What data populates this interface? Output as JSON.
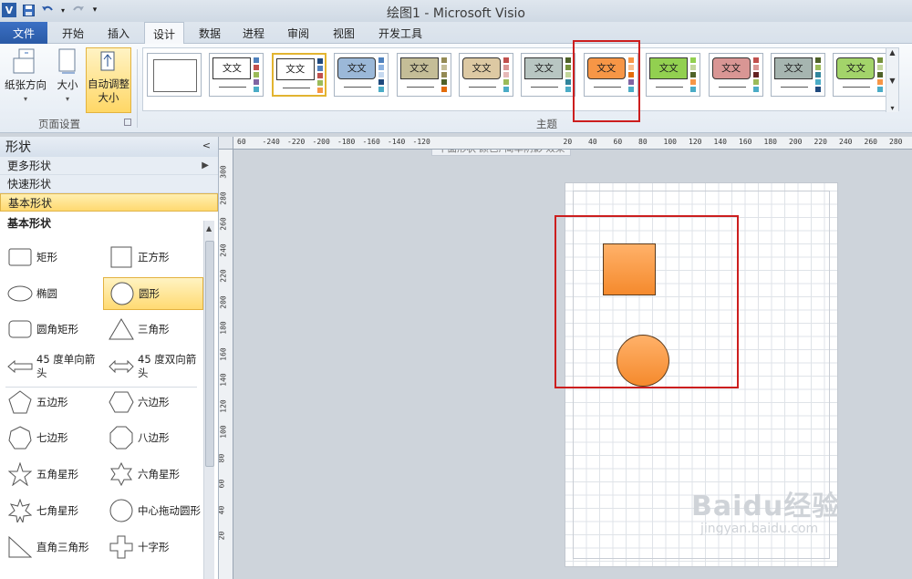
{
  "titlebar": {
    "title": "绘图1 - Microsoft Visio"
  },
  "qat": {
    "app_icon": "V",
    "items": [
      "save-icon",
      "undo-icon",
      "redo-icon",
      "customize-qat-icon"
    ]
  },
  "tabs": {
    "file": "文件",
    "items": [
      "开始",
      "插入",
      "设计",
      "数据",
      "进程",
      "审阅",
      "视图",
      "开发工具"
    ],
    "active": "设计"
  },
  "ribbon": {
    "page_setup": {
      "orientation": "纸张方向",
      "size": "大小",
      "auto_size_line1": "自动调整",
      "auto_size_line2": "大小",
      "group_label": "页面设置"
    },
    "themes": {
      "group_label": "主题",
      "sample_text": "文文",
      "tooltip": "平面形状 颜色, 简单阴影 效果",
      "items": [
        {
          "fill": "#ffffff",
          "border": "#666666",
          "bar": [
            "#c8c8c8",
            "#c8c8c8",
            "#c8c8c8",
            "#c8c8c8",
            "#c8c8c8"
          ],
          "blank": true
        },
        {
          "fill": "#ffffff",
          "border": "#333333",
          "bar": [
            "#4f81bd",
            "#c0504d",
            "#9bbb59",
            "#8064a2",
            "#4bacc6"
          ]
        },
        {
          "fill": "#ffffff",
          "border": "#333333",
          "bar": [
            "#1f497d",
            "#4f81bd",
            "#c0504d",
            "#9bbb59",
            "#f79646"
          ],
          "selected": true
        },
        {
          "fill": "#9bb8d8",
          "border": "#333333",
          "bar": [
            "#4f81bd",
            "#8db3e2",
            "#c6d9f0",
            "#1f497d",
            "#4bacc6"
          ]
        },
        {
          "fill": "#c4bd97",
          "border": "#333333",
          "bar": [
            "#948a54",
            "#c4bd97",
            "#938953",
            "#4f6228",
            "#e36c09"
          ]
        },
        {
          "fill": "#ddc9a3",
          "border": "#333333",
          "bar": [
            "#c0504d",
            "#d99694",
            "#e6b9b8",
            "#9bbb59",
            "#4bacc6"
          ]
        },
        {
          "fill": "#b8c6c2",
          "border": "#333333",
          "bar": [
            "#4f6228",
            "#77933c",
            "#c3d69b",
            "#31859c",
            "#4bacc6"
          ]
        },
        {
          "fill": "#f79646",
          "border": "#333333",
          "bar": [
            "#f79646",
            "#fac08f",
            "#e36c09",
            "#8064a2",
            "#4bacc6"
          ]
        },
        {
          "fill": "#92d050",
          "border": "#333333",
          "bar": [
            "#92d050",
            "#c3d69b",
            "#4f6228",
            "#f79646",
            "#4bacc6"
          ]
        },
        {
          "fill": "#d99694",
          "border": "#333333",
          "bar": [
            "#c0504d",
            "#d99694",
            "#632423",
            "#9bbb59",
            "#4bacc6"
          ]
        },
        {
          "fill": "#a6b5b0",
          "border": "#333333",
          "bar": [
            "#4f6228",
            "#9bbb59",
            "#31859c",
            "#4bacc6",
            "#1f497d"
          ]
        },
        {
          "fill": "#a3d46a",
          "border": "#333333",
          "bar": [
            "#76923c",
            "#c3d69b",
            "#4f6228",
            "#f79646",
            "#4bacc6"
          ]
        }
      ]
    }
  },
  "shapes_pane": {
    "title": "形状",
    "more_shapes": "更多形状",
    "quick_shapes": "快速形状",
    "basic_shapes": "基本形状",
    "stencil_title": "基本形状",
    "items": [
      {
        "label": "矩形",
        "icon": "rectangle-icon"
      },
      {
        "label": "正方形",
        "icon": "square-icon"
      },
      {
        "label": "椭圆",
        "icon": "ellipse-icon"
      },
      {
        "label": "圆形",
        "icon": "circle-icon",
        "selected": true
      },
      {
        "label": "圆角矩形",
        "icon": "rounded-rectangle-icon"
      },
      {
        "label": "三角形",
        "icon": "triangle-icon"
      },
      {
        "label": "45 度单向箭头",
        "label_line1": "45 度单向箭",
        "label_line2": "头",
        "icon": "single-arrow-icon"
      },
      {
        "label": "45 度双向箭头",
        "label_line1": "45 度双向箭",
        "label_line2": "头",
        "icon": "double-arrow-icon"
      },
      {
        "label": "五边形",
        "icon": "pentagon-icon"
      },
      {
        "label": "六边形",
        "icon": "hexagon-icon"
      },
      {
        "label": "七边形",
        "icon": "heptagon-icon"
      },
      {
        "label": "八边形",
        "icon": "octagon-icon"
      },
      {
        "label": "五角星形",
        "icon": "five-point-star-icon"
      },
      {
        "label": "六角星形",
        "icon": "six-point-star-icon"
      },
      {
        "label": "七角星形",
        "icon": "seven-point-star-icon"
      },
      {
        "label": "中心拖动圆形",
        "icon": "center-drag-circle-icon"
      },
      {
        "label": "直角三角形",
        "icon": "right-triangle-icon"
      },
      {
        "label": "十字形",
        "icon": "cross-icon"
      }
    ]
  },
  "rulers": {
    "horizontal": [
      "60",
      "-240",
      "-220",
      "-200",
      "-180",
      "-160",
      "-140",
      "-120",
      "",
      "",
      "",
      "",
      "",
      "20",
      "40",
      "60",
      "80",
      "100",
      "120",
      "140",
      "160",
      "180",
      "200",
      "220",
      "240",
      "260",
      "280"
    ],
    "vertical": [
      "300",
      "280",
      "260",
      "240",
      "220",
      "200",
      "180",
      "160",
      "140",
      "120",
      "100",
      "80",
      "60",
      "40",
      "20"
    ]
  },
  "canvas": {
    "shapes": [
      "square",
      "circle"
    ],
    "fill": "#f79646"
  },
  "watermark": {
    "brand": "Baidu经验",
    "url": "jingyan.baidu.com"
  }
}
